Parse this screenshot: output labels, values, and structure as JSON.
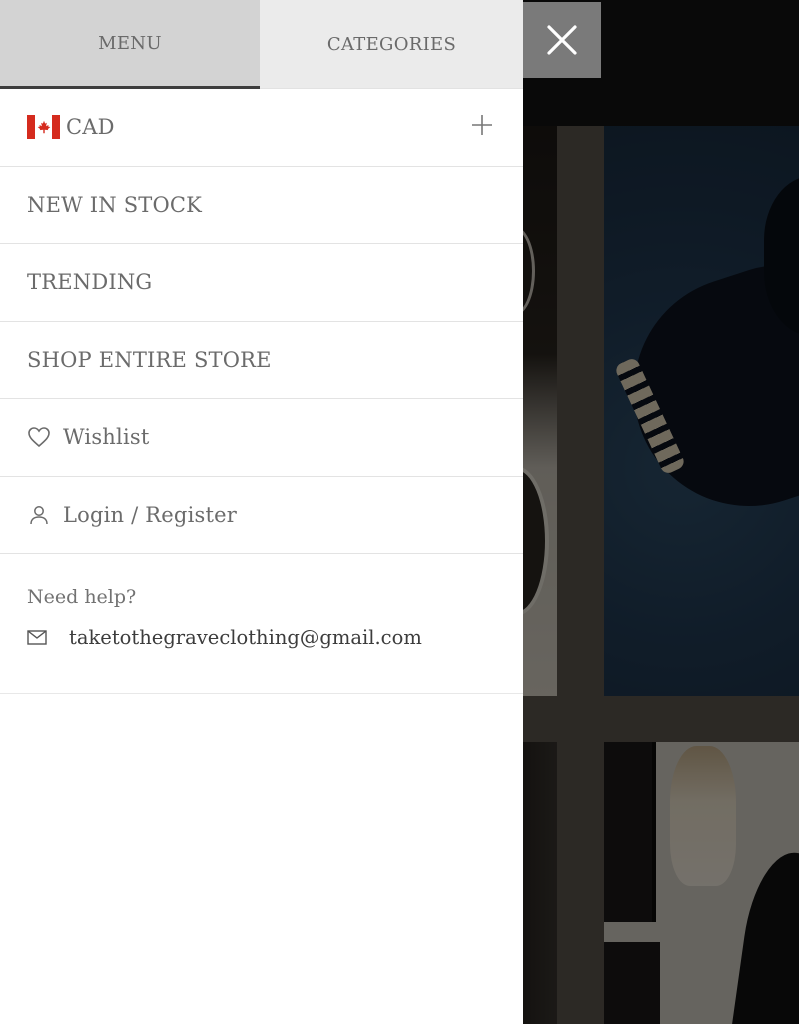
{
  "tabs": {
    "menu": "MENU",
    "categories": "CATEGORIES"
  },
  "currency": {
    "code": "CAD",
    "flag_icon": "canada-flag-icon",
    "expand_icon": "plus-icon"
  },
  "menu_items": [
    {
      "label": "NEW IN STOCK"
    },
    {
      "label": "TRENDING"
    },
    {
      "label": "SHOP ENTIRE STORE"
    }
  ],
  "wishlist": {
    "label": "Wishlist",
    "icon": "heart-icon"
  },
  "account": {
    "label": "Login / Register",
    "icon": "user-icon"
  },
  "help": {
    "title": "Need help?",
    "email": "taketothegraveclothing@gmail.com",
    "icon": "mail-icon"
  },
  "close": {
    "icon": "close-icon"
  },
  "colors": {
    "tab_active_bg": "#d3d3d3",
    "tab_inactive_bg": "#ebebeb",
    "close_bg": "#7a7a7a",
    "flag_red": "#d52b1e"
  }
}
